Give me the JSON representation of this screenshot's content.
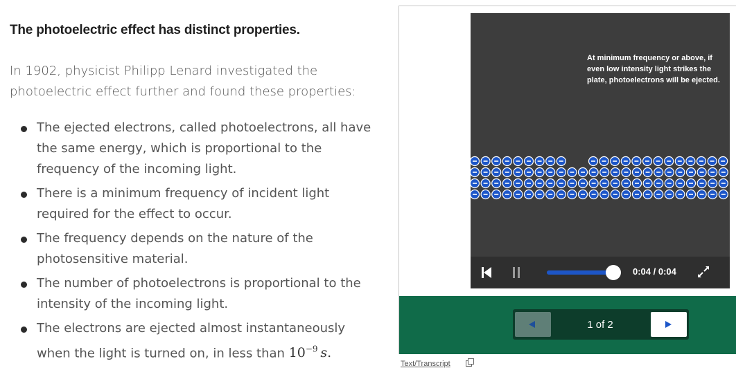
{
  "article": {
    "heading": "The photoelectric effect has distinct properties.",
    "intro": "In 1902, physicist Philipp Lenard investigated the photoelectric effect further and found these properties:",
    "bullets": [
      "The ejected electrons, called photoelectrons, all have the same energy, which is proportional to the frequency of the incoming light.",
      "There is a minimum frequency of incident light required for the effect to occur.",
      "The frequency depends on the nature of the photosensitive material.",
      "The number of photoelectrons is proportional to the intensity of the incoming light.",
      "The electrons are ejected almost instantaneously when the light is turned on, in less than"
    ],
    "math": {
      "base": "10",
      "exponent": "−9",
      "unit": "s",
      "end": "."
    }
  },
  "player": {
    "caption": "At minimum frequency or above, if even low intensity light strikes the plate, photoelectrons will be ejected.",
    "time": "0:04 / 0:04",
    "progress": 1.0,
    "icons": {
      "skip_back": "skip-back-icon",
      "pause": "pause-icon",
      "expand": "expand-icon"
    }
  },
  "slides": {
    "page_label": "1 of 2",
    "prev_icon": "left-triangle-icon",
    "next_icon": "right-triangle-icon"
  },
  "footer": {
    "transcript_label": "Text/Transcript"
  },
  "colors": {
    "panel_green": "#106b49",
    "video_bg": "#3d3d3d",
    "electron_blue": "#1d56c8"
  }
}
